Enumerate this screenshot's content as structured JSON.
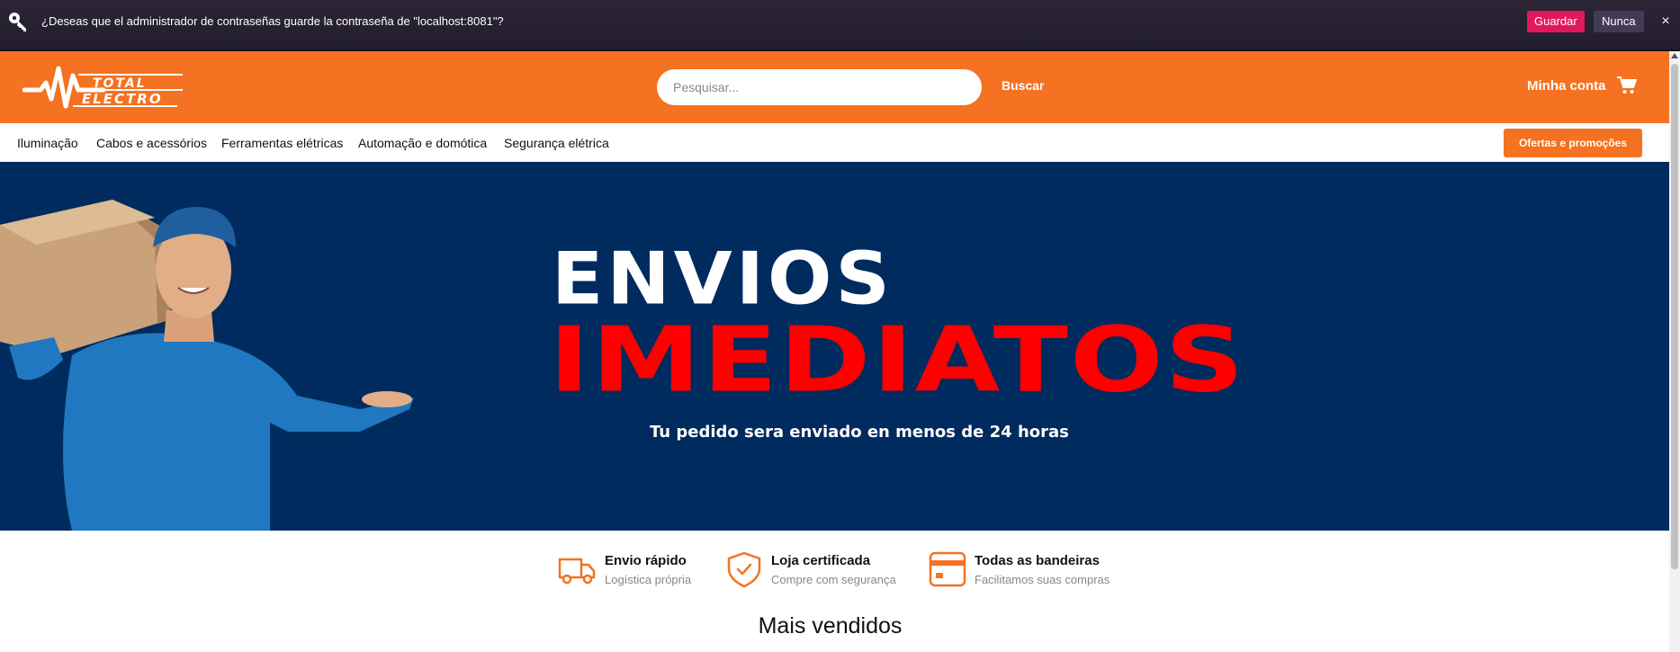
{
  "password_bar": {
    "message": "¿Deseas que el administrador de contraseñas guarde la contraseña de \"localhost:8081\"?",
    "save_label": "Guardar",
    "never_label": "Nunca",
    "close_label": "×"
  },
  "header": {
    "logo_line1": "TOTAL",
    "logo_line2": "ELECTRO",
    "search_placeholder": "Pesquisar...",
    "search_button": "Buscar",
    "account_label": "Minha conta"
  },
  "nav": {
    "items": [
      {
        "label": "Iluminação"
      },
      {
        "label": "Cabos e acessórios"
      },
      {
        "label": "Ferramentas elétricas"
      },
      {
        "label": "Automação e domótica"
      },
      {
        "label": "Segurança elétrica"
      }
    ],
    "promo_button": "Ofertas e promoções"
  },
  "hero": {
    "line1": "ENVIOS",
    "line2": "IMEDIATOS",
    "subtitle": "Tu pedido sera enviado en menos de 24 horas"
  },
  "features": [
    {
      "icon": "truck-icon",
      "title": "Envio rápido",
      "subtitle": "Logística própria"
    },
    {
      "icon": "shield-check-icon",
      "title": "Loja certificada",
      "subtitle": "Compre com segurança"
    },
    {
      "icon": "credit-card-icon",
      "title": "Todas as bandeiras",
      "subtitle": "Facilitamos suas compras"
    }
  ],
  "section": {
    "title": "Mais vendidos"
  },
  "colors": {
    "brand_orange": "#f47221",
    "hero_navy": "#002b5e",
    "hero_red": "#ff0000",
    "save_pink": "#e1195a"
  }
}
